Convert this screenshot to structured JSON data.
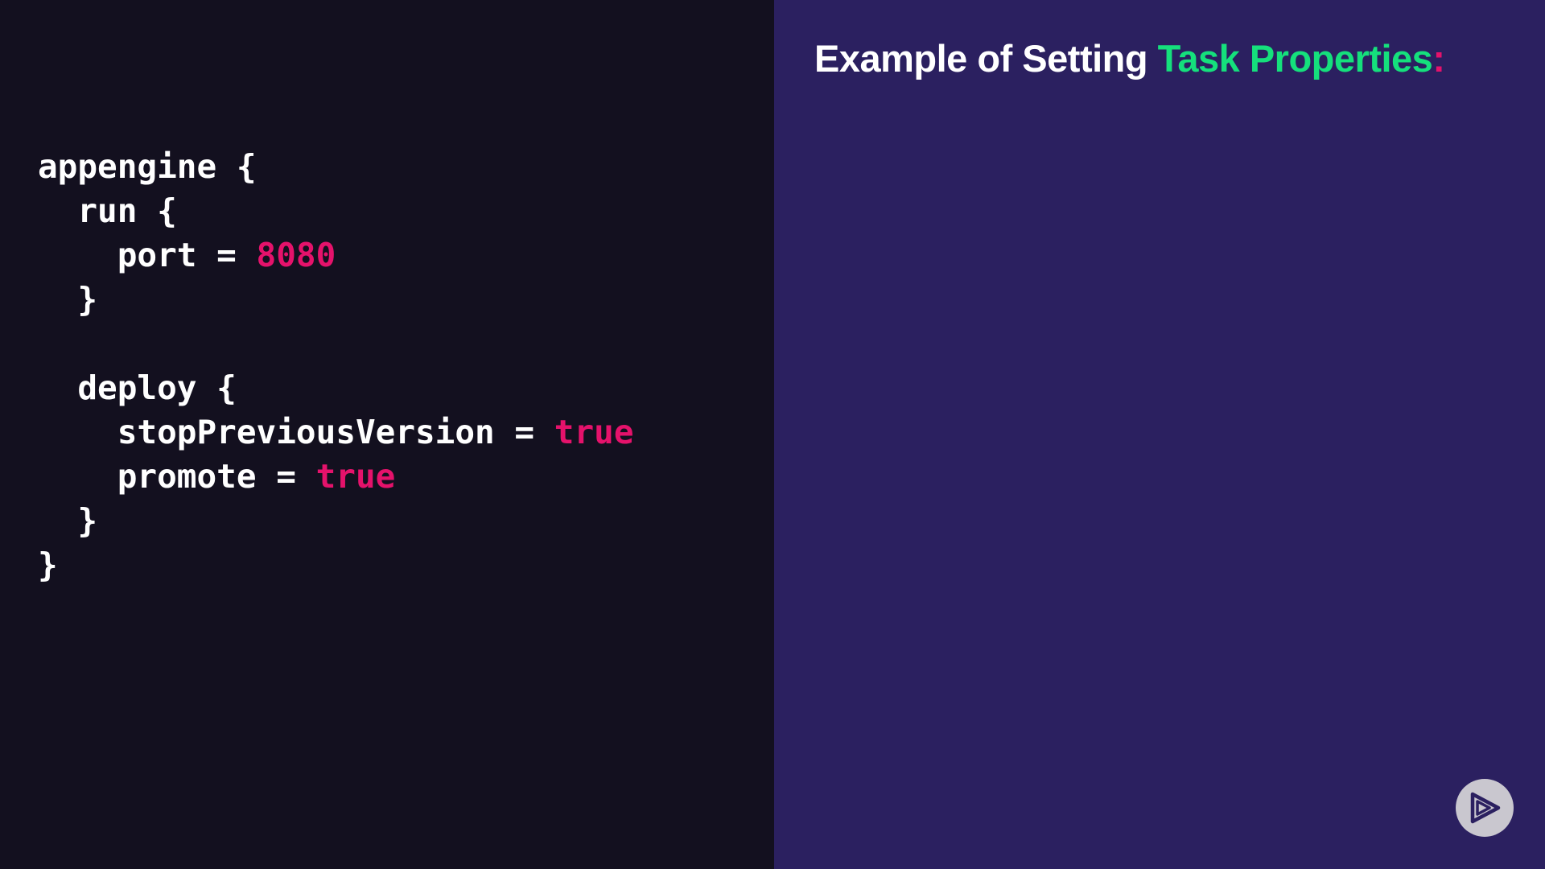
{
  "title": {
    "prefix": "Example of Setting ",
    "highlight": "Task Properties",
    "suffix": ":"
  },
  "code": {
    "lines": [
      [
        {
          "text": "appengine {",
          "kind": "plain"
        }
      ],
      [
        {
          "text": "  run {",
          "kind": "plain"
        }
      ],
      [
        {
          "text": "    port = ",
          "kind": "plain"
        },
        {
          "text": "8080",
          "kind": "num"
        }
      ],
      [
        {
          "text": "  }",
          "kind": "plain"
        }
      ],
      [
        {
          "text": "",
          "kind": "plain"
        }
      ],
      [
        {
          "text": "  deploy {",
          "kind": "plain"
        }
      ],
      [
        {
          "text": "    stopPreviousVersion = ",
          "kind": "plain"
        },
        {
          "text": "true",
          "kind": "bool"
        }
      ],
      [
        {
          "text": "    promote = ",
          "kind": "plain"
        },
        {
          "text": "true",
          "kind": "bool"
        }
      ],
      [
        {
          "text": "  }",
          "kind": "plain"
        }
      ],
      [
        {
          "text": "}",
          "kind": "plain"
        }
      ]
    ]
  },
  "colors": {
    "code_background": "#13101f",
    "content_background": "#2b2060",
    "accent_green": "#15e07c",
    "accent_pink": "#e5126b",
    "text": "#ffffff"
  },
  "icons": {
    "logo": "play-logo-icon"
  }
}
